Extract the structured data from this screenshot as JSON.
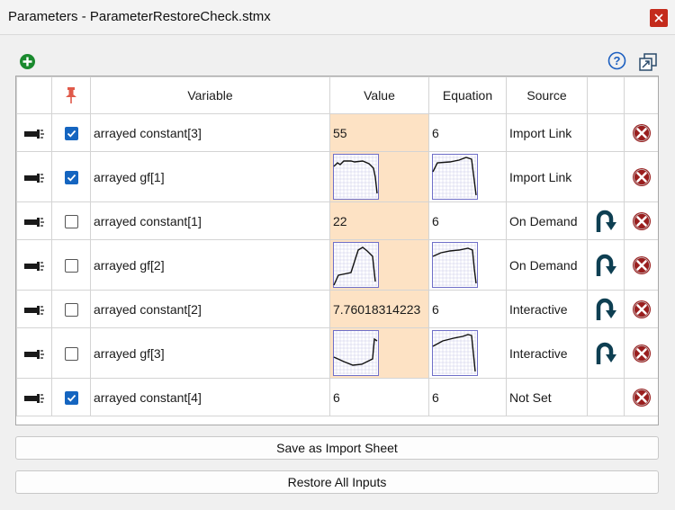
{
  "window": {
    "title": "Parameters - ParameterRestoreCheck.stmx"
  },
  "toolbar": {
    "add_icon": "plus-circle-icon",
    "help_icon": "question-circle-icon",
    "popout_icon": "window-popout-icon"
  },
  "table": {
    "columns": [
      "",
      "",
      "Variable",
      "Value",
      "Equation",
      "Source",
      "",
      ""
    ],
    "rows": [
      {
        "checked": true,
        "variable": "arrayed constant[3]",
        "value": "55",
        "equation": "6",
        "source": "Import Link",
        "restore": false,
        "kind": "const"
      },
      {
        "checked": true,
        "variable": "arrayed gf[1]",
        "value": "",
        "equation": "",
        "source": "Import Link",
        "restore": false,
        "kind": "gf"
      },
      {
        "checked": false,
        "variable": "arrayed constant[1]",
        "value": "22",
        "equation": "6",
        "source": "On Demand",
        "restore": true,
        "kind": "const"
      },
      {
        "checked": false,
        "variable": "arrayed gf[2]",
        "value": "",
        "equation": "",
        "source": "On Demand",
        "restore": true,
        "kind": "gf"
      },
      {
        "checked": false,
        "variable": "arrayed constant[2]",
        "value": "7.76018314223",
        "equation": "6",
        "source": "Interactive",
        "restore": true,
        "kind": "const"
      },
      {
        "checked": false,
        "variable": "arrayed gf[3]",
        "value": "",
        "equation": "",
        "source": "Interactive",
        "restore": true,
        "kind": "gf"
      },
      {
        "checked": true,
        "variable": "arrayed constant[4]",
        "value": "6",
        "equation": "6",
        "source": "Not Set",
        "restore": false,
        "kind": "const"
      }
    ]
  },
  "buttons": {
    "save_import": "Save as Import Sheet",
    "restore_all": "Restore All Inputs"
  },
  "colors": {
    "value_bg": "#fde2c4",
    "checkbox": "#1565c0",
    "delete": "#9a1e1e",
    "restore": "#0e3f52",
    "add": "#1a8a2e",
    "help": "#1c5fc0"
  }
}
